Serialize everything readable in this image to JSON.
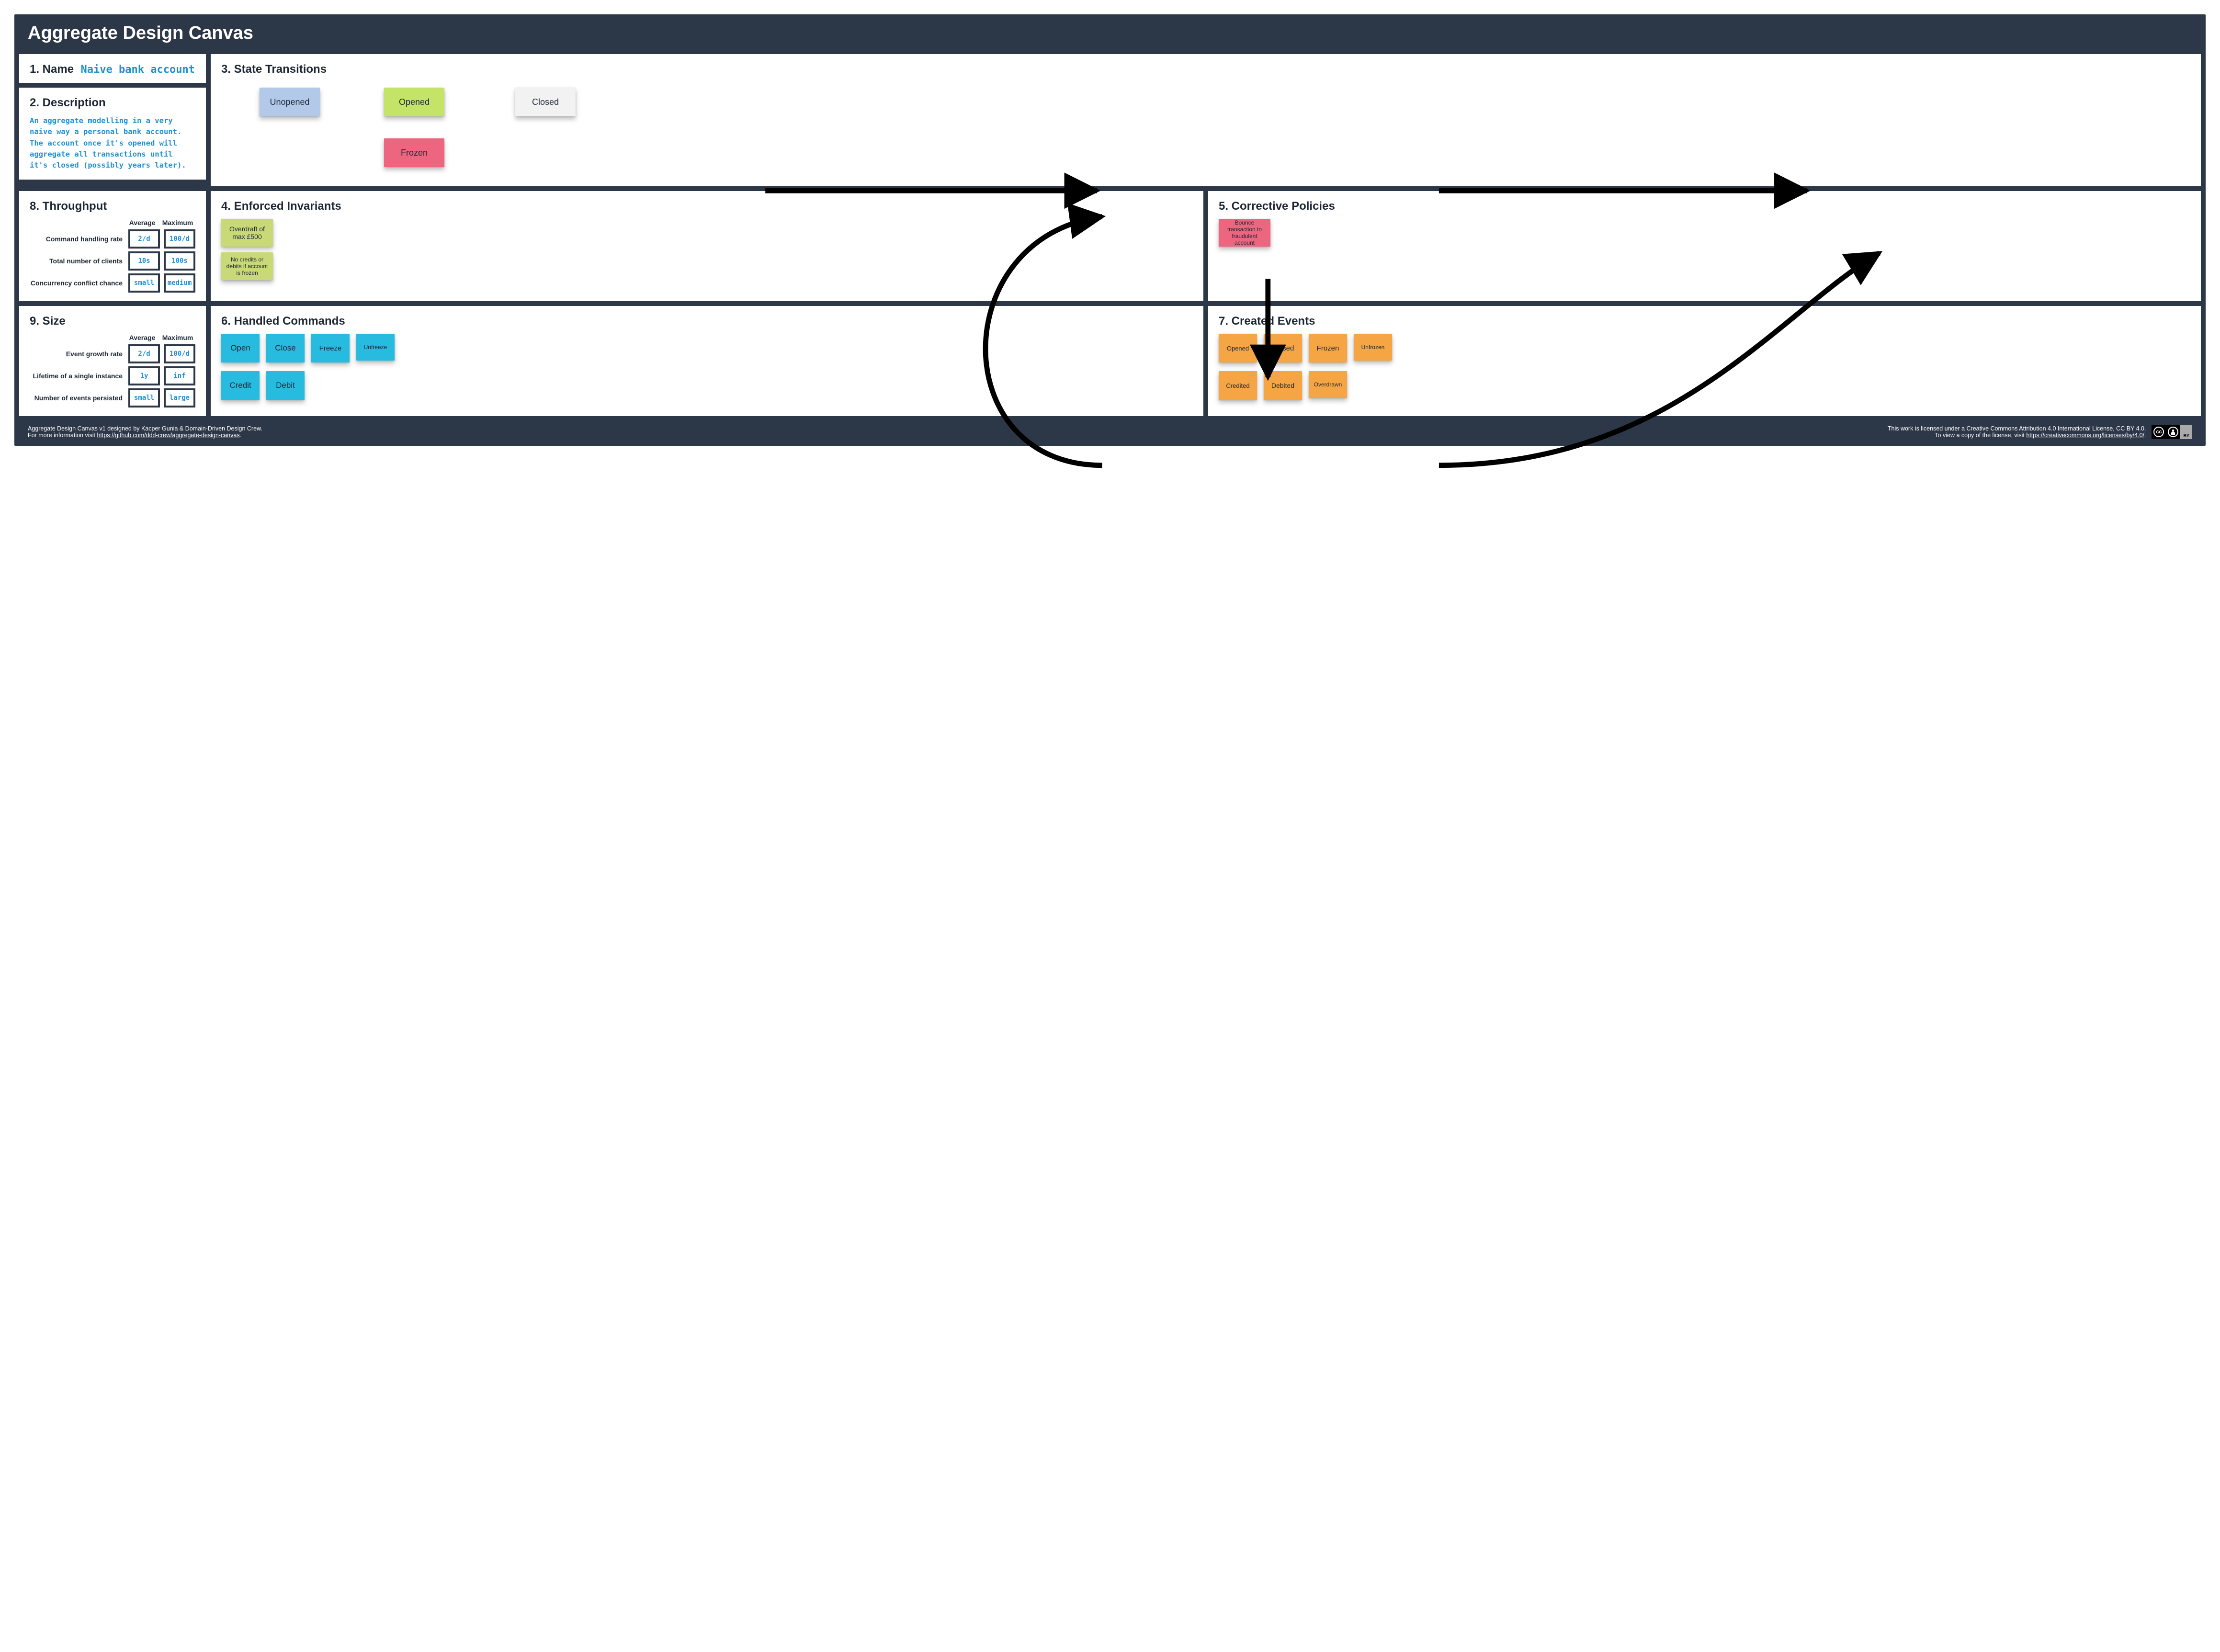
{
  "title": "Aggregate Design Canvas",
  "sections": {
    "name": {
      "heading": "1. Name",
      "value": "Naive bank account"
    },
    "description": {
      "heading": "2. Description",
      "text": "An aggregate modelling in a very\nnaive way a personal bank account.\nThe account once it's opened will\naggregate all transactions until\nit's closed (possibly years later)."
    },
    "state_transitions": {
      "heading": "3. State Transitions",
      "states": {
        "unopened": "Unopened",
        "opened": "Opened",
        "closed": "Closed",
        "frozen": "Frozen"
      }
    },
    "invariants": {
      "heading": "4. Enforced Invariants",
      "items": [
        "Overdraft of max £500",
        "No credits or debits if account is frozen"
      ]
    },
    "policies": {
      "heading": "5. Corrective Policies",
      "items": [
        "Bounce transaction to fraudulent account"
      ]
    },
    "commands": {
      "heading": "6. Handled Commands",
      "items": [
        "Open",
        "Close",
        "Freeze",
        "Unfreeze",
        "Credit",
        "Debit"
      ]
    },
    "events": {
      "heading": "7. Created Events",
      "items": [
        "Opened",
        "Closed",
        "Frozen",
        "Unfrozen",
        "Credited",
        "Debited",
        "Overdrawn"
      ]
    },
    "throughput": {
      "heading": "8. Throughput",
      "col_avg": "Average",
      "col_max": "Maximum",
      "rows": [
        {
          "label": "Command handling rate",
          "avg": "2/d",
          "max": "100/d"
        },
        {
          "label": "Total number of clients",
          "avg": "10s",
          "max": "100s"
        },
        {
          "label": "Concurrency conflict chance",
          "avg": "small",
          "max": "medium"
        }
      ]
    },
    "size": {
      "heading": "9. Size",
      "col_avg": "Average",
      "col_max": "Maximum",
      "rows": [
        {
          "label": "Event growth rate",
          "avg": "2/d",
          "max": "100/d"
        },
        {
          "label": "Lifetime of a single instance",
          "avg": "1y",
          "max": "inf"
        },
        {
          "label": "Number of events persisted",
          "avg": "small",
          "max": "large"
        }
      ]
    }
  },
  "footer": {
    "left_line1": "Aggregate Design Canvas v1 designed by Kacper Gunia & Domain-Driven Design Crew.",
    "left_line2_pre": "For more information visit ",
    "left_link": "https://github.com/ddd-crew/aggregate-design-canvas",
    "right_line1": "This work is licensed under a Creative Commons Attribution 4.0 International License, CC BY 4.0.",
    "right_line2_pre": "To view a copy of the license, visit ",
    "right_link": "https://creativecommons.org/licenses/by/4.0/",
    "cc": "cc",
    "by": "BY"
  }
}
